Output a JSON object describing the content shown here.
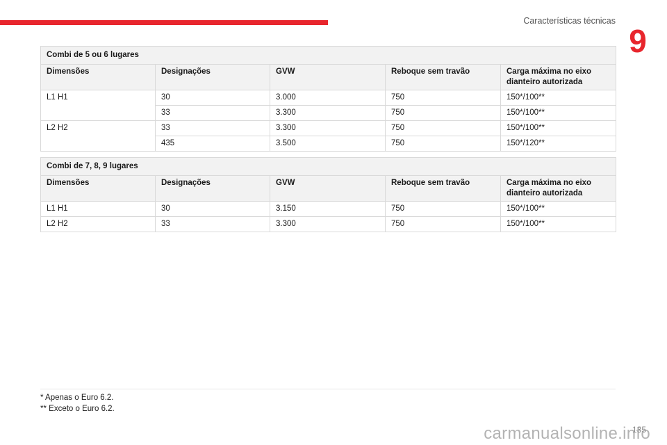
{
  "header": {
    "section_title": "Características técnicas",
    "chapter_number": "9"
  },
  "tables": [
    {
      "caption": "Combi de 5 ou 6 lugares",
      "columns": [
        "Dimensões",
        "Designações",
        "GVW",
        "Reboque sem travão",
        "Carga máxima no eixo dianteiro autorizada"
      ],
      "rows": [
        [
          "L1 H1",
          "30",
          "3.000",
          "750",
          "150*/100**"
        ],
        [
          "",
          "33",
          "3.300",
          "750",
          "150*/100**"
        ],
        [
          "L2 H2",
          "33",
          "3.300",
          "750",
          "150*/100**"
        ],
        [
          "",
          "435",
          "3.500",
          "750",
          "150*/120**"
        ]
      ]
    },
    {
      "caption": "Combi de 7, 8, 9 lugares",
      "columns": [
        "Dimensões",
        "Designações",
        "GVW",
        "Reboque sem travão",
        "Carga máxima no eixo dianteiro autorizada"
      ],
      "rows": [
        [
          "L1 H1",
          "30",
          "3.150",
          "750",
          "150*/100**"
        ],
        [
          "L2 H2",
          "33",
          "3.300",
          "750",
          "150*/100**"
        ]
      ]
    }
  ],
  "footnotes": [
    "* Apenas o Euro 6.2.",
    "** Exceto o Euro 6.2."
  ],
  "page_number": "135",
  "watermark": "carmanualsonline.info",
  "colors": {
    "accent_red": "#e8262d",
    "header_fill": "#f2f2f2",
    "grid": "#d9d9d9"
  }
}
